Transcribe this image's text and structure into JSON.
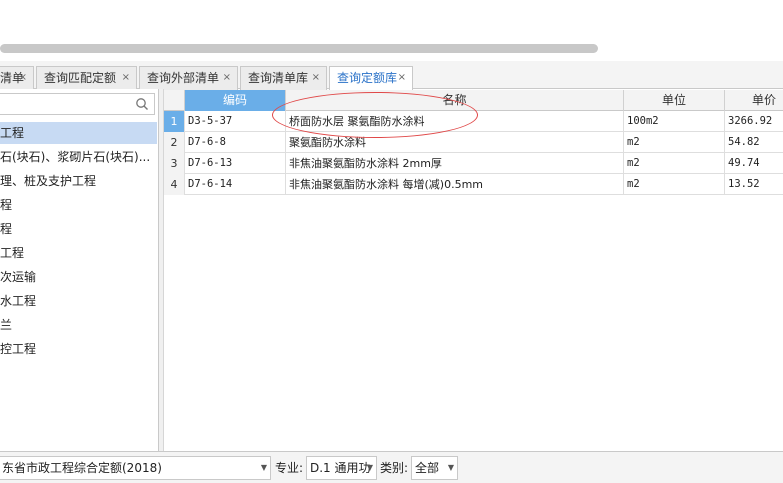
{
  "tabs": [
    {
      "label": "清单",
      "close": "×"
    },
    {
      "label": "查询匹配定额",
      "close": "×"
    },
    {
      "label": "查询外部清单",
      "close": "×"
    },
    {
      "label": "查询清单库",
      "close": "×"
    },
    {
      "label": "查询定额库",
      "close": "×",
      "active": true
    }
  ],
  "search": {
    "value": "",
    "placeholder": ""
  },
  "tree": {
    "items": [
      {
        "label": "工程",
        "selected": true
      },
      {
        "label": "石(块石)、浆砌片石(块石)..."
      },
      {
        "label": "理、桩及支护工程"
      },
      {
        "label": "程"
      },
      {
        "label": "程"
      },
      {
        "label": "工程"
      },
      {
        "label": "次运输"
      },
      {
        "label": "水工程"
      },
      {
        "label": "兰"
      },
      {
        "label": "控工程"
      }
    ]
  },
  "grid": {
    "columns": [
      "",
      "编码",
      "名称",
      "单位",
      "单价"
    ],
    "rows": [
      {
        "num": "1",
        "code": "D3-5-37",
        "name": "桥面防水层 聚氨酯防水涂料",
        "unit": "100m2",
        "price": "3266.92"
      },
      {
        "num": "2",
        "code": "D7-6-8",
        "name": "聚氨酯防水涂料",
        "unit": "m2",
        "price": "54.82"
      },
      {
        "num": "3",
        "code": "D7-6-13",
        "name": "非焦油聚氨酯防水涂料 2mm厚",
        "unit": "m2",
        "price": "49.74"
      },
      {
        "num": "4",
        "code": "D7-6-14",
        "name": "非焦油聚氨酯防水涂料 每增(减)0.5mm",
        "unit": "m2",
        "price": "13.52"
      }
    ]
  },
  "bottom": {
    "quota_lib": "东省市政工程综合定额(2018)",
    "major_label": "专业:",
    "major_value": "D.1 通用功",
    "category_label": "类别:",
    "category_value": "全部",
    "arrow": "▼"
  },
  "colors": {
    "accent": "#6aaee8",
    "annotation": "#e04848",
    "active_tab_text": "#2a72c8"
  }
}
